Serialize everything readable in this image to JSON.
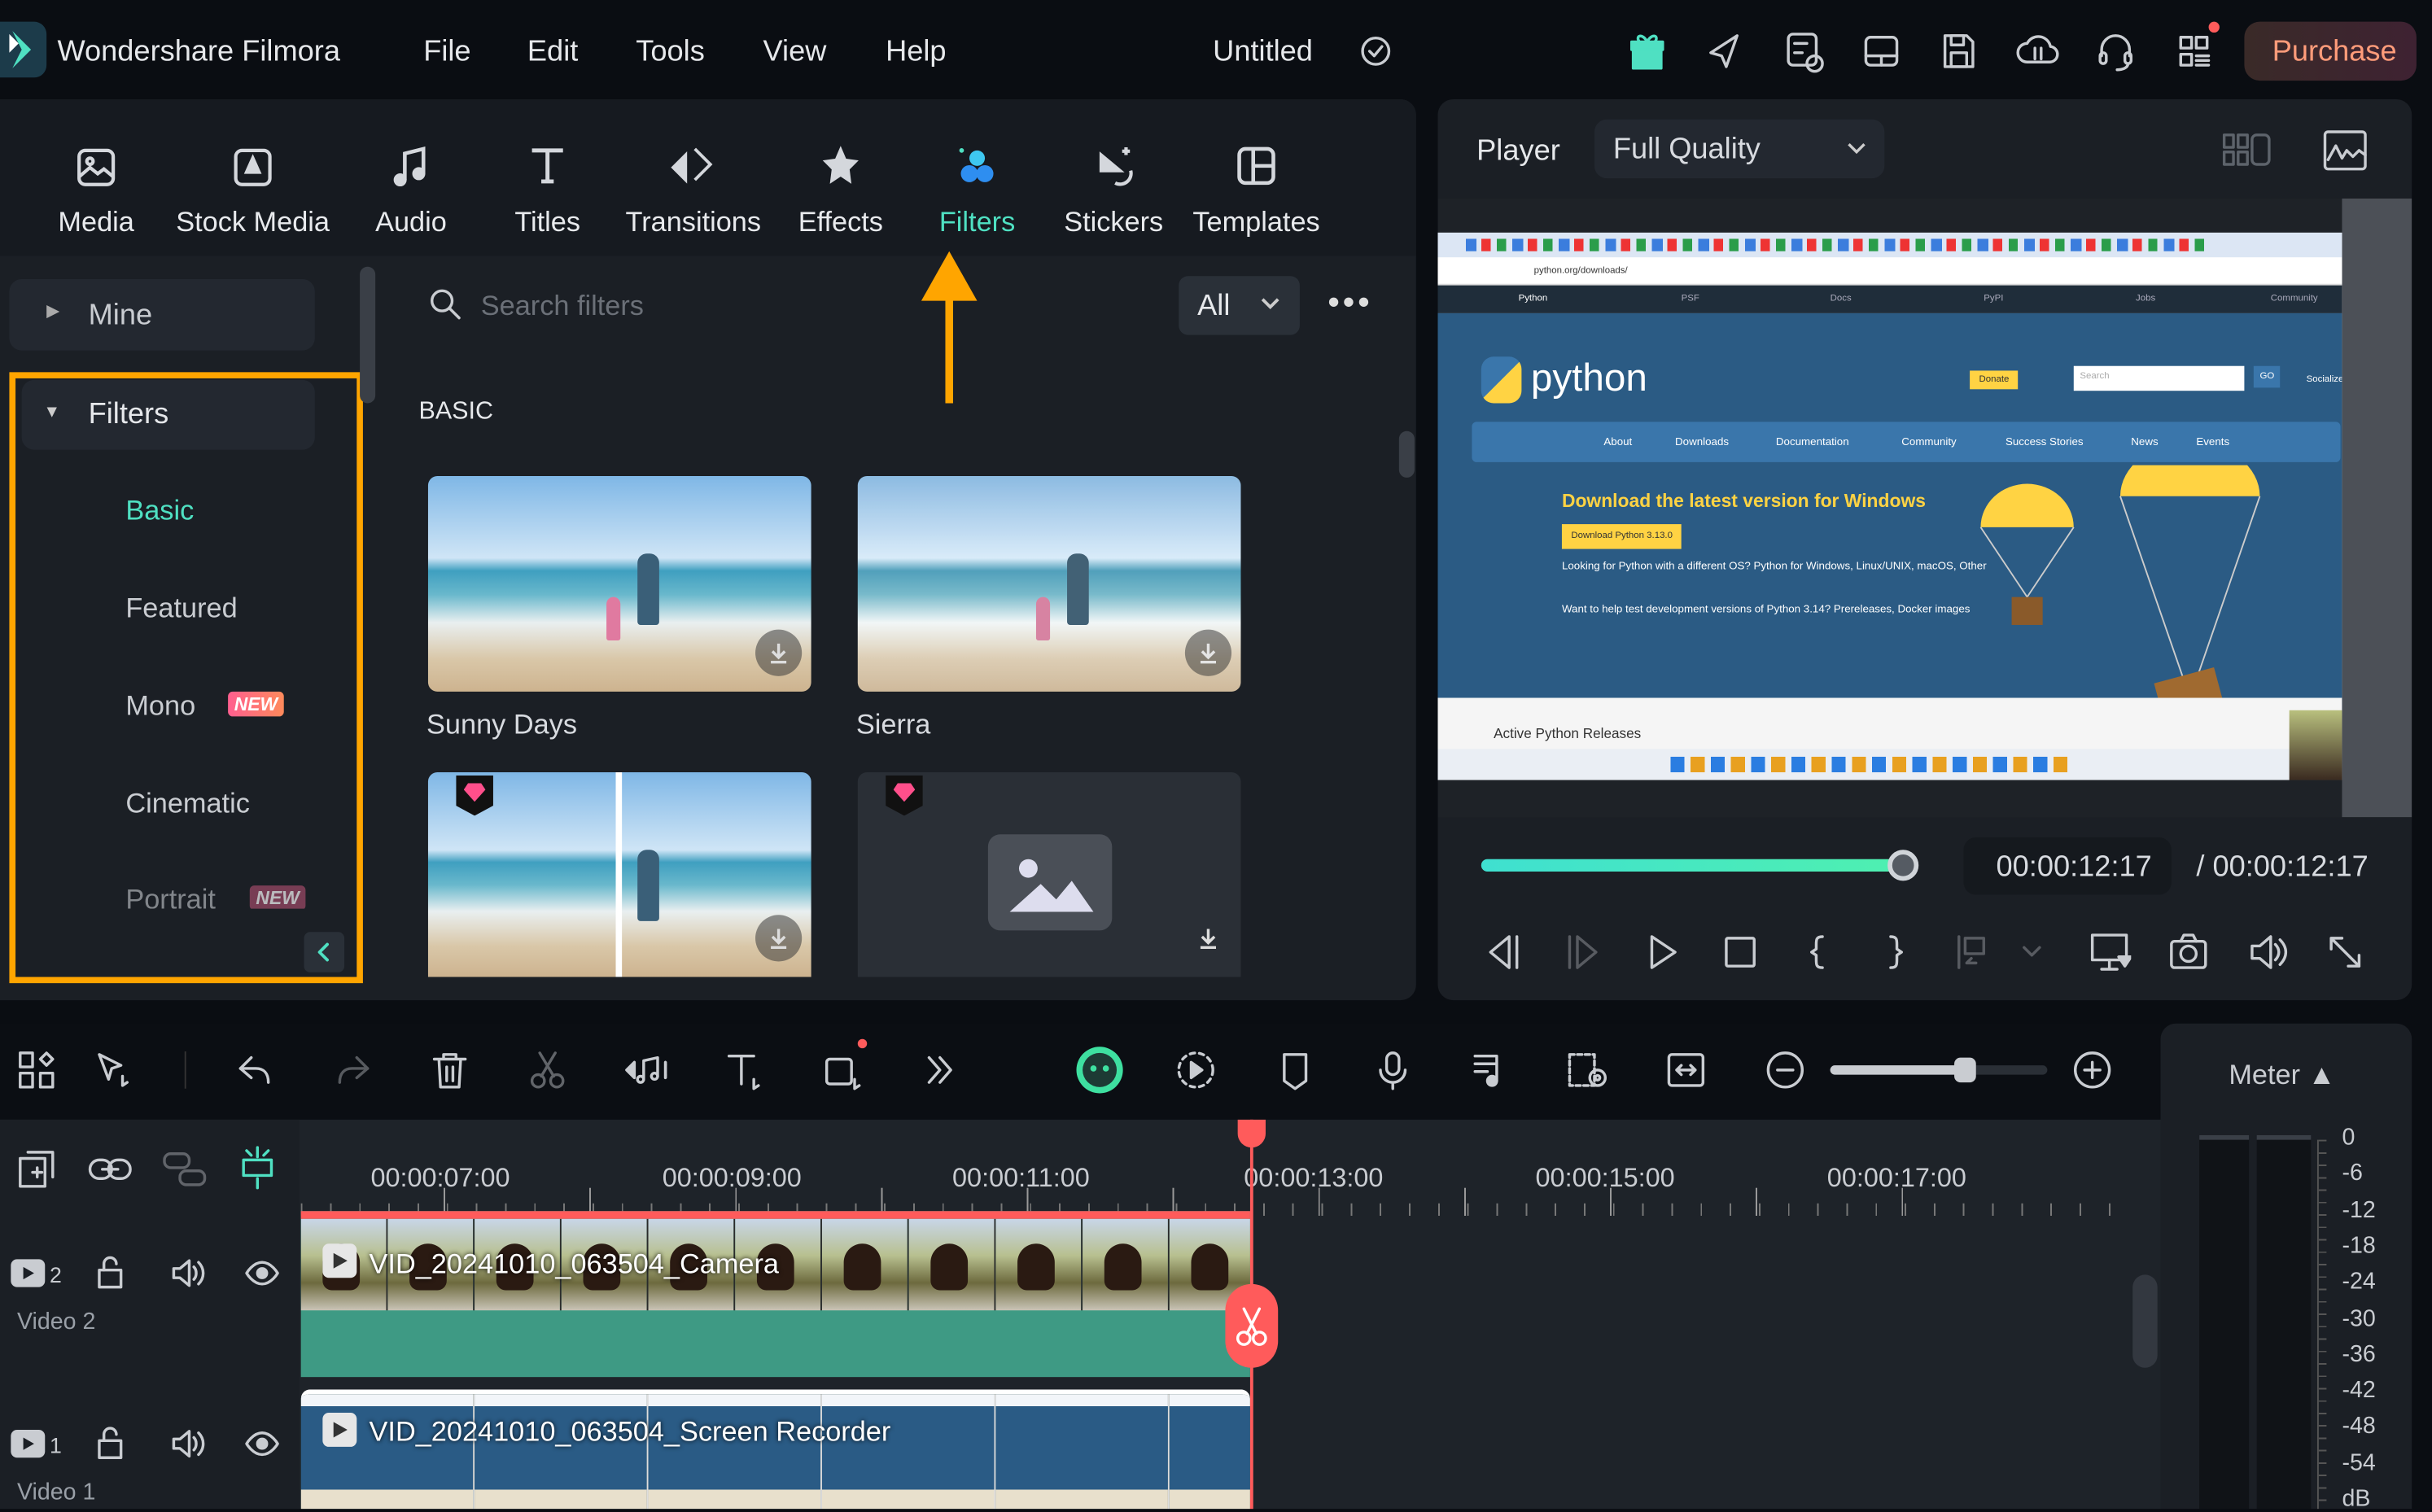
{
  "app": {
    "name": "Wondershare Filmora",
    "project_title": "Untitled",
    "menu": [
      "File",
      "Edit",
      "Tools",
      "View",
      "Help"
    ],
    "purchase_label": "Purchase",
    "accent": "#4fe0c2",
    "highlight": "#ffa500"
  },
  "topbar_icons": [
    "gift-icon",
    "send-icon",
    "schedule-icon",
    "layout-icon",
    "save-icon",
    "cloud-icon",
    "headset-icon",
    "apps-icon"
  ],
  "media_tabs": [
    {
      "label": "Media"
    },
    {
      "label": "Stock Media"
    },
    {
      "label": "Audio"
    },
    {
      "label": "Titles"
    },
    {
      "label": "Transitions"
    },
    {
      "label": "Effects"
    },
    {
      "label": "Filters",
      "active": true
    },
    {
      "label": "Stickers"
    },
    {
      "label": "Templates"
    }
  ],
  "sidebar": {
    "mine": "Mine",
    "filters": "Filters",
    "items": [
      {
        "label": "Basic",
        "active": true
      },
      {
        "label": "Featured"
      },
      {
        "label": "Mono",
        "badge": "NEW"
      },
      {
        "label": "Cinematic"
      },
      {
        "label": "Portrait",
        "badge": "NEW"
      }
    ]
  },
  "search": {
    "placeholder": "Search filters",
    "filter_value": "All"
  },
  "section_title": "BASIC",
  "filters": [
    {
      "name": "Sunny Days"
    },
    {
      "name": "Sierra"
    },
    {
      "name": "",
      "premium": true
    },
    {
      "name": "",
      "premium": true
    }
  ],
  "player": {
    "label": "Player",
    "quality": "Full Quality",
    "current_time": "00:00:12:17",
    "total_time": "/  00:00:12:17",
    "progress_percent": 100
  },
  "preview": {
    "url": "python.org/downloads/",
    "nav_tabs": [
      "Python",
      "PSF",
      "Docs",
      "PyPI",
      "Jobs",
      "Community"
    ],
    "logo_text": "python",
    "donate": "Donate",
    "search": "Search",
    "go": "GO",
    "socialize": "Socialize",
    "menu": [
      "About",
      "Downloads",
      "Documentation",
      "Community",
      "Success Stories",
      "News",
      "Events"
    ],
    "heading": "Download the latest version for Windows",
    "download_button": "Download Python 3.13.0",
    "text1": "Looking for Python with a different OS? Python for Windows, Linux/UNIX, macOS, Other",
    "text2": "Want to help test development versions of Python 3.14? Prereleases, Docker images",
    "releases": "Active Python Releases"
  },
  "timeline": {
    "ruler": [
      "00:00:07:00",
      "00:00:09:00",
      "00:00:11:00",
      "00:00:13:00",
      "00:00:15:00",
      "00:00:17:00"
    ],
    "zoom_percent": 62,
    "tracks": [
      {
        "number": "2",
        "name": "Video 2",
        "clip": "VID_20241010_063504_Camera"
      },
      {
        "number": "1",
        "name": "Video 1",
        "clip": "VID_20241010_063504_Screen Recorder"
      }
    ],
    "playhead_color": "#ff5b5b",
    "clip_color": "#3e9a84"
  },
  "meter": {
    "label": "Meter ▲",
    "scale": [
      "0",
      "-6",
      "-12",
      "-18",
      "-24",
      "-30",
      "-36",
      "-42",
      "-48",
      "-54",
      "dB"
    ]
  }
}
